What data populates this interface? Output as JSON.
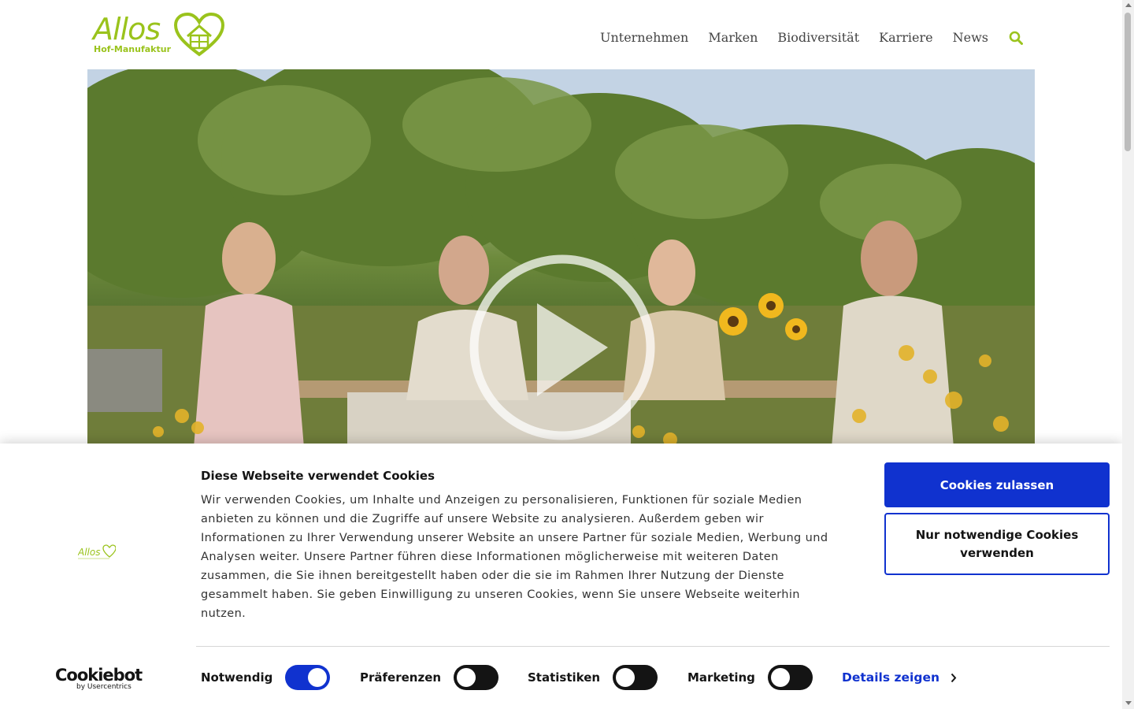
{
  "header": {
    "logo": {
      "name": "Allos",
      "tagline": "Hof-Manufaktur"
    },
    "nav": [
      "Unternehmen",
      "Marken",
      "Biodiversität",
      "Karriere",
      "News"
    ],
    "search_icon": "search-icon",
    "brand_color": "#9ac31c"
  },
  "hero": {
    "play_icon": "play-icon"
  },
  "cookie_banner": {
    "title": "Diese Webseite verwendet Cookies",
    "text": "Wir verwenden Cookies, um Inhalte und Anzeigen zu personalisieren, Funktionen für soziale Medien anbieten zu können und die Zugriffe auf unsere Website zu analysieren. Außerdem geben wir Informationen zu Ihrer Verwendung unserer Website an unsere Partner für soziale Medien, Werbung und Analysen weiter. Unsere Partner führen diese Informationen möglicherweise mit weiteren Daten zusammen, die Sie ihnen bereitgestellt haben oder die sie im Rahmen Ihrer Nutzung der Dienste gesammelt haben. Sie geben Einwilligung zu unseren Cookies, wenn Sie unsere Webseite weiterhin nutzen.",
    "allow_button": "Cookies zulassen",
    "necessary_button": "Nur notwendige Cookies verwenden",
    "toggles": [
      {
        "label": "Notwendig",
        "on": true
      },
      {
        "label": "Präferenzen",
        "on": false
      },
      {
        "label": "Statistiken",
        "on": false
      },
      {
        "label": "Marketing",
        "on": false
      }
    ],
    "details_link": "Details zeigen",
    "provider": {
      "name": "Cookiebot",
      "sub": "by Usercentrics"
    },
    "accent_color": "#1032cf"
  }
}
